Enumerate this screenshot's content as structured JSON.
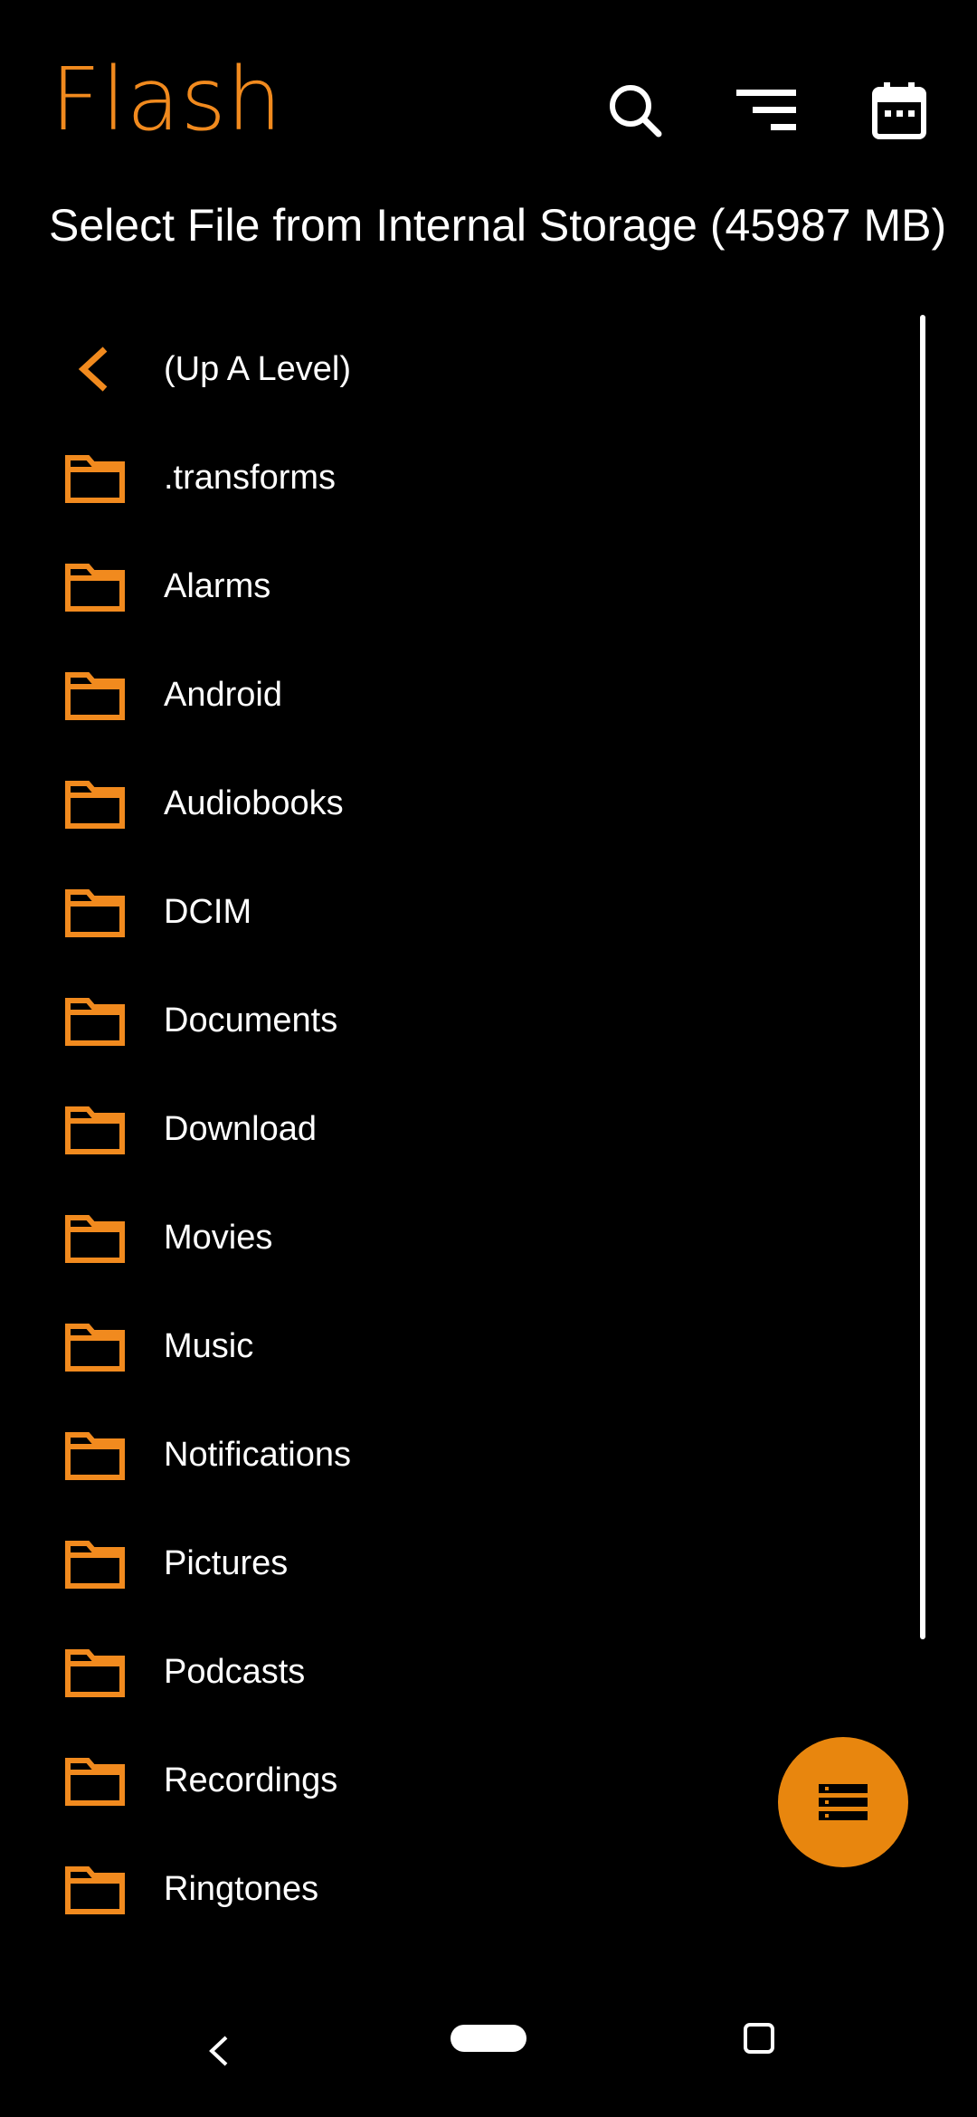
{
  "app": {
    "title": "Flash",
    "accent_color": "#F18A1E",
    "fab_color": "#E8860E"
  },
  "toolbar": {
    "search_icon": "search-icon",
    "sort_icon": "sort-icon",
    "calendar_icon": "calendar-icon"
  },
  "header": {
    "subtitle": "Select File from Internal Storage (45987 MB)"
  },
  "list": {
    "up_level": {
      "label": "(Up A Level)",
      "icon": "chevron-left-icon"
    },
    "folders": [
      {
        "label": ".transforms",
        "icon": "folder-icon"
      },
      {
        "label": "Alarms",
        "icon": "folder-icon"
      },
      {
        "label": "Android",
        "icon": "folder-icon"
      },
      {
        "label": "Audiobooks",
        "icon": "folder-icon"
      },
      {
        "label": "DCIM",
        "icon": "folder-icon"
      },
      {
        "label": "Documents",
        "icon": "folder-icon"
      },
      {
        "label": "Download",
        "icon": "folder-icon"
      },
      {
        "label": "Movies",
        "icon": "folder-icon"
      },
      {
        "label": "Music",
        "icon": "folder-icon"
      },
      {
        "label": "Notifications",
        "icon": "folder-icon"
      },
      {
        "label": "Pictures",
        "icon": "folder-icon"
      },
      {
        "label": "Podcasts",
        "icon": "folder-icon"
      },
      {
        "label": "Recordings",
        "icon": "folder-icon"
      },
      {
        "label": "Ringtones",
        "icon": "folder-icon"
      }
    ]
  },
  "fab": {
    "icon": "storage-list-icon"
  },
  "navbar": {
    "back_icon": "nav-back-icon",
    "home_icon": "nav-home-pill",
    "recents_icon": "nav-recents-icon"
  }
}
